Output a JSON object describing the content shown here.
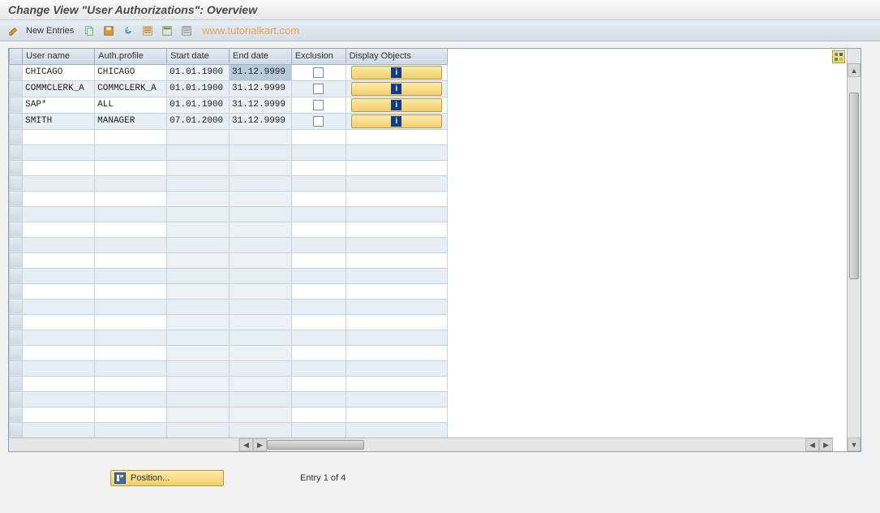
{
  "header": {
    "title": "Change View \"User Authorizations\": Overview"
  },
  "toolbar": {
    "new_entries_label": "New Entries"
  },
  "watermark": "www.tutorialkart.com",
  "columns": {
    "user": "User name",
    "auth": "Auth.profile",
    "start": "Start date",
    "end": "End date",
    "excl": "Exclusion",
    "disp": "Display Objects"
  },
  "rows": [
    {
      "user": "CHICAGO",
      "auth": "CHICAGO",
      "start": "01.01.1900",
      "end": "31.12.9999",
      "end_highlight": true
    },
    {
      "user": "COMMCLERK_A",
      "auth": "COMMCLERK_A",
      "start": "01.01.1900",
      "end": "31.12.9999"
    },
    {
      "user": "SAP*",
      "auth": "ALL",
      "start": "01.01.1900",
      "end": "31.12.9999"
    },
    {
      "user": "SMITH",
      "auth": "MANAGER",
      "start": "07.01.2000",
      "end": "31.12.9999"
    }
  ],
  "empty_rows": 20,
  "footer": {
    "position_label": "Position...",
    "entry_status": "Entry 1 of 4"
  }
}
